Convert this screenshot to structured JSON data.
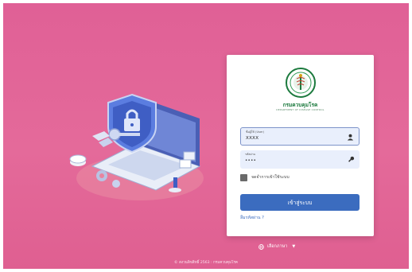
{
  "logo": {
    "name_th": "กรมควบคุมโรค",
    "name_en": "DEPARTMENT OF DISEASE CONTROL"
  },
  "form": {
    "username": {
      "label": "ชื่อผู้ใช้ (User)",
      "value": "XXXX",
      "icon": "user-icon"
    },
    "password": {
      "label": "รหัสผ่าน",
      "value": "••••",
      "icon": "key-icon"
    },
    "remember_label": "จดจำการเข้าใช้ระบบ",
    "login_label": "เข้าสู่ระบบ",
    "forgot_label": "ลืมรหัสผ่าน ?"
  },
  "language": {
    "label": "เลือกภาษา",
    "icon": "globe-icon"
  },
  "footer": {
    "text": "© สงวนลิขสิทธิ์ 2563 : กรมควบคุมโรค"
  },
  "colors": {
    "background": "#e06096",
    "primary": "#3b6cbf",
    "field_bg": "#e9effc",
    "logo_green": "#1c7a3e"
  }
}
